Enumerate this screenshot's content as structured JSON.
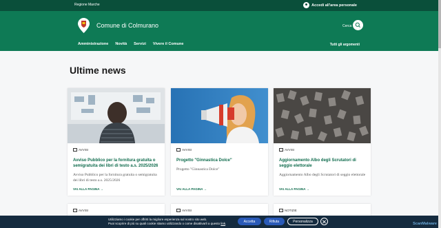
{
  "topbar": {
    "region": "Regione Marche",
    "login": "Accedi all'area personale"
  },
  "header": {
    "site_name": "Comune di Colmurano",
    "search_label": "Cerca"
  },
  "nav": {
    "items": [
      "Amministrazione",
      "Novità",
      "Servizi",
      "Vivere il Comune"
    ],
    "right": "Tutti gli argomenti"
  },
  "main": {
    "heading": "Ultime news"
  },
  "cards": [
    {
      "category": "AVVISI",
      "title": "Avviso Pubblico per la fornitura gratuita o semigratuita dei libri di testo a.s. 2025/2026",
      "description": "Avviso Pubblico per la fornitura gratuita o semigratuita dei libri di testo a.s. 2025/2026",
      "link": "VAI ALLA PAGINA"
    },
    {
      "category": "AVVISI",
      "title": "Progetto \"Ginnastica Dolce\"",
      "description": "Progetto \"Ginnastica Dolce\"",
      "link": "VAI ALLA PAGINA"
    },
    {
      "category": "AVVISI",
      "title": "Aggiornamento Albo degli Scrutatori di seggio elettorale",
      "description": "Aggiornamento Albo degli Scrutatori di seggio elettorale",
      "link": "VAI ALLA PAGINA"
    }
  ],
  "cards_row2": [
    {
      "category": "AVVISI"
    },
    {
      "category": "AVVISI"
    },
    {
      "category": "NOTIZIE"
    }
  ],
  "cookie": {
    "line1": "Utilizziamo i cookie per offrirti la migliore esperienza sul nostro sito web.",
    "line2": "Puoi scoprire di più su quali cookie stiamo utilizzando o come disattivarli a questo",
    "privacy_link": "link",
    "accept": "Accetta",
    "reject": "Rifiuta",
    "customize": "Personalizza"
  },
  "watermark": "ScanMalware",
  "colors": {
    "topbar": "#0a4f3a",
    "header": "#0e7a55",
    "link_green": "#0e6b4c",
    "cookie_bg": "#152b3f",
    "button_blue": "#2a5ab8"
  }
}
